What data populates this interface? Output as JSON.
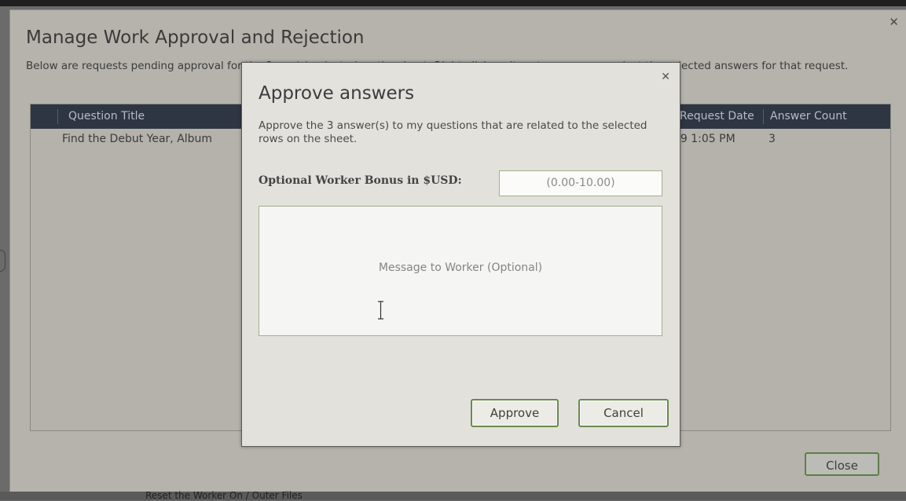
{
  "outer_dialog": {
    "title": "Manage Work Approval and Rejection",
    "description": "Below are requests pending approval for the 3 row(s) selected on the sheet. Right-click an item to approve or reject the selected answers for that request.",
    "close_icon": "close-icon",
    "grid": {
      "columns": [
        "Question Title",
        "Request Date",
        "Answer Count"
      ],
      "rows": [
        {
          "question_title": "Find the Debut Year, Album",
          "request_date": "09 1:05 PM",
          "answer_count": "3"
        }
      ]
    },
    "close_button": "Close"
  },
  "approve_modal": {
    "title": "Approve answers",
    "description": "Approve the 3 answer(s) to my questions that are related to the selected rows on the sheet.",
    "bonus_label": "Optional Worker Bonus in $USD:",
    "bonus_placeholder": "(0.00-10.00)",
    "message_placeholder": "Message to Worker (Optional)",
    "approve_button": "Approve",
    "cancel_button": "Cancel",
    "close_icon": "close-icon"
  },
  "background": {
    "footer_text": "Reset the Worker On / Outer Files"
  },
  "colors": {
    "header_bg": "#2e3643",
    "button_border": "#6b8a4e",
    "modal_bg": "#e3e1dc"
  }
}
